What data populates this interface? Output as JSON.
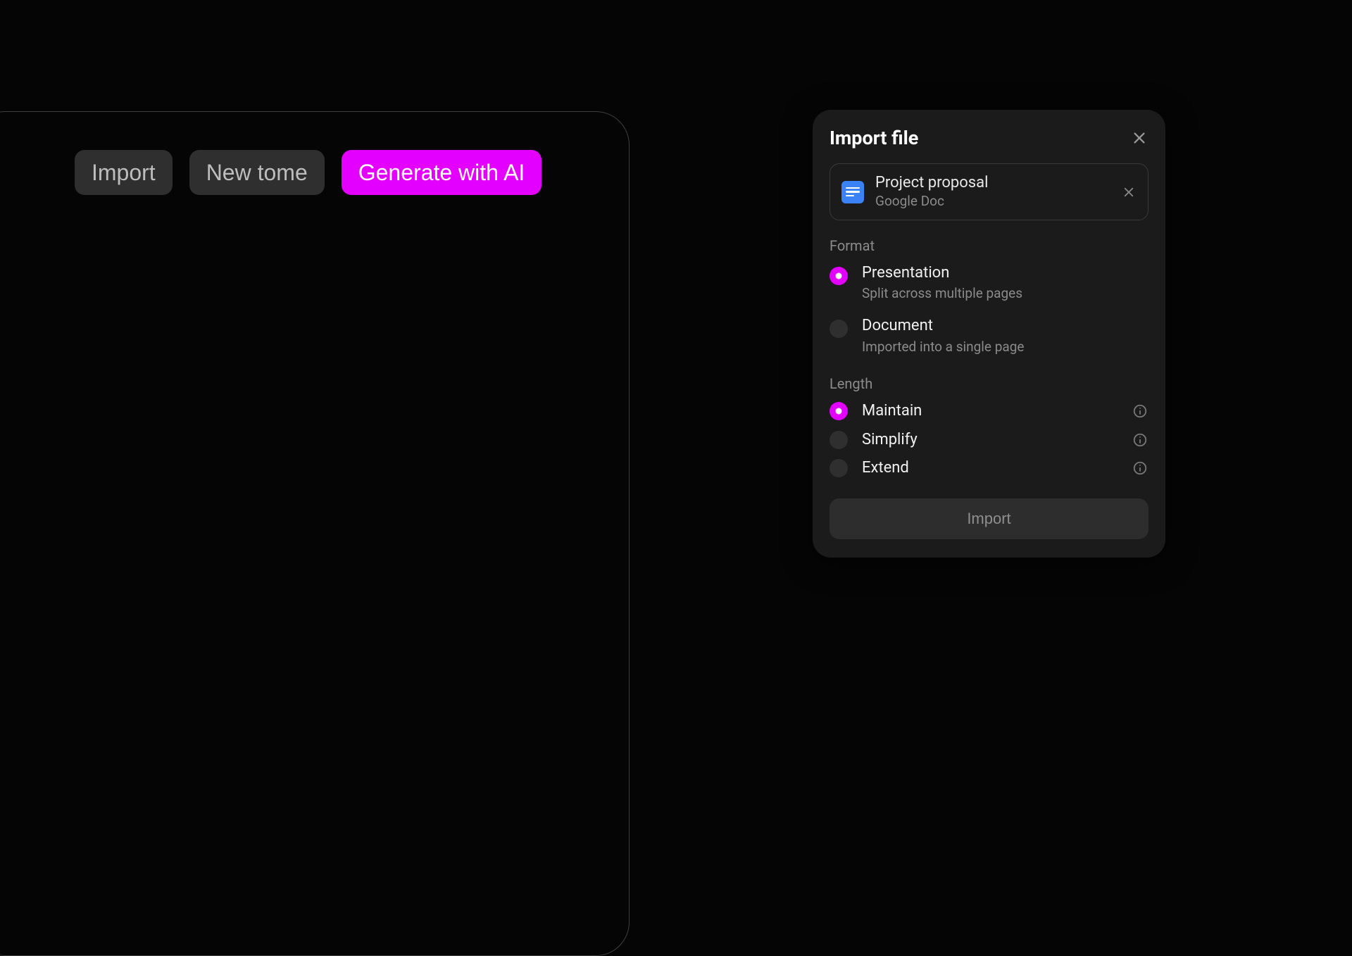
{
  "toolbar": {
    "import_label": "Import",
    "new_tome_label": "New tome",
    "generate_label": "Generate with AI"
  },
  "dialog": {
    "title": "Import file",
    "file": {
      "name": "Project proposal",
      "type": "Google Doc",
      "icon": "google-doc-icon"
    },
    "format": {
      "label": "Format",
      "options": [
        {
          "title": "Presentation",
          "desc": "Split across multiple pages",
          "selected": true
        },
        {
          "title": "Document",
          "desc": "Imported into a single page",
          "selected": false
        }
      ]
    },
    "length": {
      "label": "Length",
      "options": [
        {
          "title": "Maintain",
          "selected": true,
          "has_info": true
        },
        {
          "title": "Simplify",
          "selected": false,
          "has_info": true
        },
        {
          "title": "Extend",
          "selected": false,
          "has_info": true
        }
      ]
    },
    "import_button": "Import"
  },
  "colors": {
    "accent": "#e400ff",
    "doc_icon": "#3b82f6"
  }
}
